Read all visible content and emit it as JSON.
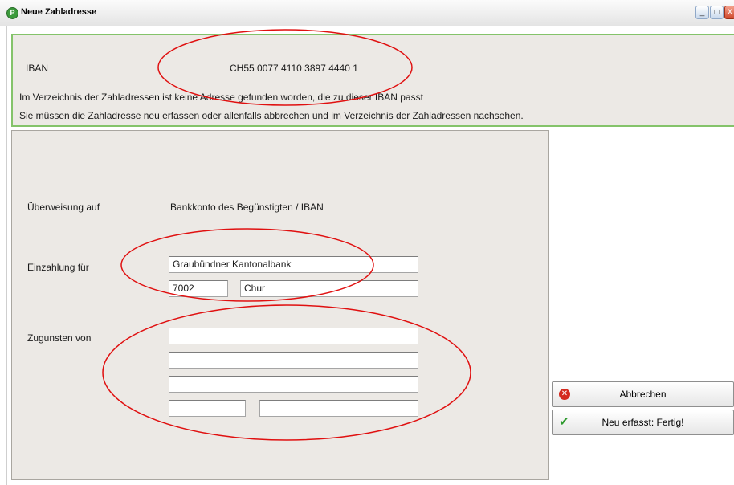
{
  "window": {
    "title": "Neue Zahladresse",
    "app_icon_glyph": "P",
    "minimize_glyph": "_",
    "maximize_glyph": "□",
    "close_glyph": "X"
  },
  "info": {
    "iban_label": "IBAN",
    "iban_value": "CH55 0077 4110 3897 4440 1",
    "message_line1": "Im Verzeichnis der Zahladressen ist keine Adresse gefunden worden, die zu dieser IBAN passt",
    "message_line2": "Sie müssen die Zahladresse neu erfassen oder allenfalls abbrechen und im Verzeichnis der Zahladressen nachsehen."
  },
  "form": {
    "ueberweisung_label": "Überweisung auf",
    "ueberweisung_value": "Bankkonto des Begünstigten / IBAN",
    "einzahlung_label": "Einzahlung für",
    "bank_name": "Graubündner Kantonalbank",
    "bank_plz": "7002",
    "bank_ort": "Chur",
    "zugunsten_label": "Zugunsten von",
    "zugunsten_line1": "",
    "zugunsten_line2": "",
    "zugunsten_line3": "",
    "zugunsten_plz": "",
    "zugunsten_ort": ""
  },
  "buttons": {
    "cancel_label": "Abbrechen",
    "cancel_icon": "cancel-icon",
    "done_label": "Neu erfasst: Fertig!",
    "done_icon": "checkmark-icon"
  },
  "colors": {
    "panel_border_green": "#84c36a",
    "annotation_red": "#e01010",
    "panel_background": "#ece9e5"
  }
}
